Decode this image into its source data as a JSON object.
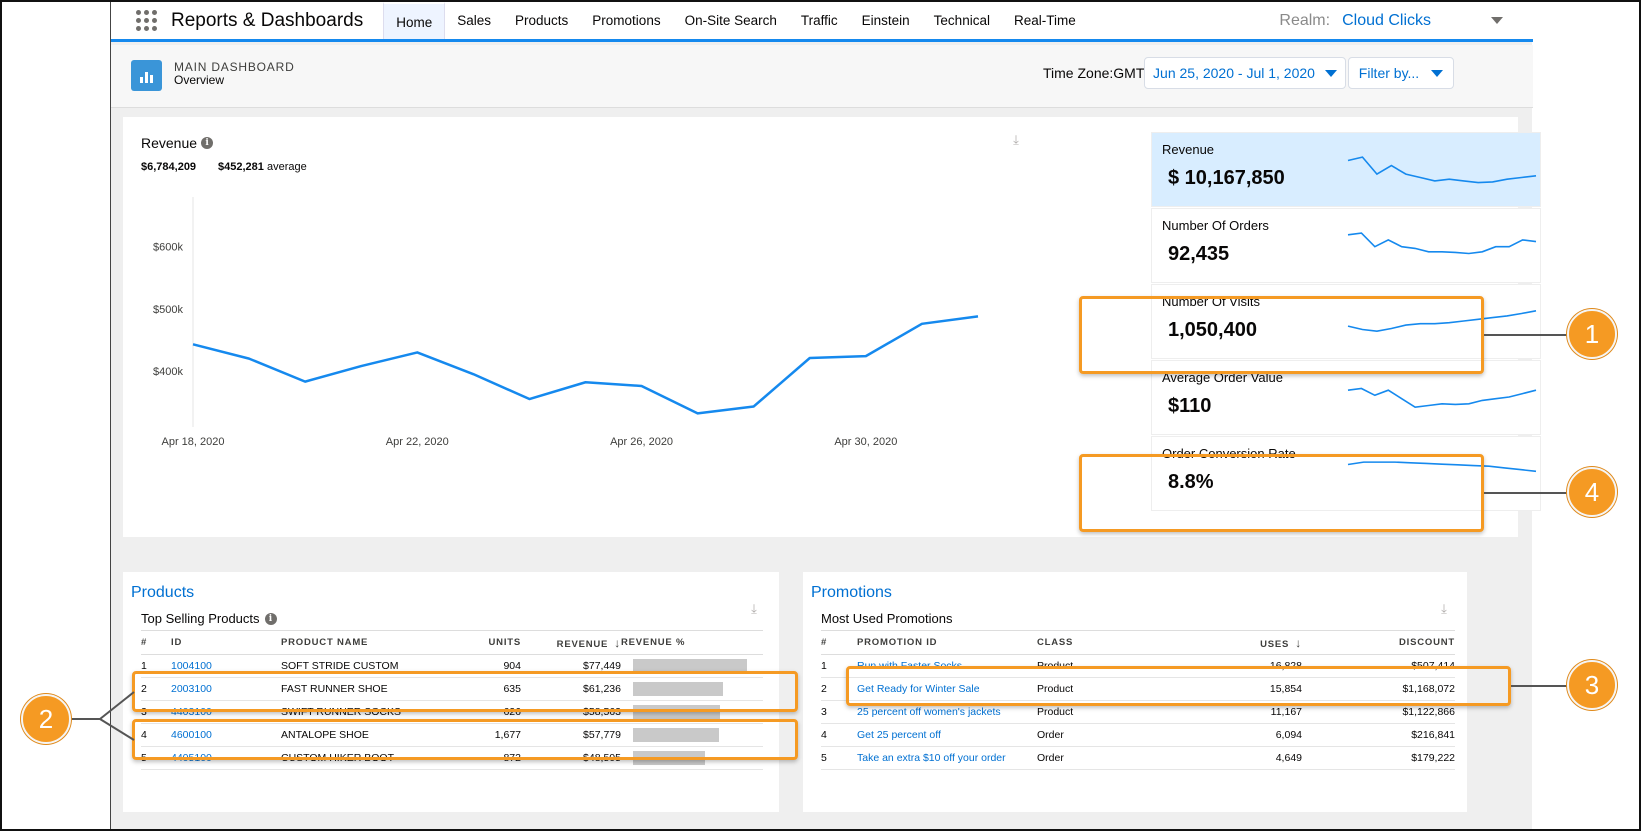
{
  "nav": {
    "app_title": "Reports & Dashboards",
    "tabs": [
      "Home",
      "Sales",
      "Products",
      "Promotions",
      "On-Site Search",
      "Traffic",
      "Einstein",
      "Technical",
      "Real-Time"
    ],
    "active_tab": "Home",
    "realm_label": "Realm:",
    "realm_value": "Cloud Clicks"
  },
  "header": {
    "title": "MAIN DASHBOARD",
    "subtitle": "Overview",
    "timezone_label": "Time Zone:GMT",
    "date_range": "Jun 25, 2020 - Jul 1, 2020",
    "filter_label": "Filter by..."
  },
  "revenue": {
    "title": "Revenue",
    "total": "$6,784,209",
    "average_value": "$452,281",
    "average_label": "average"
  },
  "chart_data": {
    "type": "line",
    "title": "Revenue",
    "x_ticks": [
      "Apr 18, 2020",
      "Apr 22, 2020",
      "Apr 26, 2020",
      "Apr 30, 2020"
    ],
    "y_ticks": [
      "$400k",
      "$500k",
      "$600k"
    ],
    "ylim": [
      310000,
      680000
    ],
    "xlim_days": [
      0,
      14
    ],
    "x": [
      "Apr 18, 2020",
      "Apr 19, 2020",
      "Apr 20, 2020",
      "Apr 21, 2020",
      "Apr 22, 2020",
      "Apr 23, 2020",
      "Apr 24, 2020",
      "Apr 25, 2020",
      "Apr 26, 2020",
      "Apr 27, 2020",
      "Apr 28, 2020",
      "Apr 29, 2020",
      "Apr 30, 2020",
      "May 1, 2020",
      "May 2, 2020"
    ],
    "values": [
      443000,
      420000,
      383000,
      408000,
      430000,
      395000,
      355000,
      382000,
      376000,
      332000,
      343000,
      421000,
      424000,
      476000,
      488000
    ],
    "color": "#1589ee",
    "grid": false
  },
  "kpis": [
    {
      "label": "Revenue",
      "value": "$ 10,167,850",
      "selected": true,
      "spark": [
        0.75,
        0.85,
        0.35,
        0.6,
        0.35,
        0.25,
        0.15,
        0.2,
        0.15,
        0.1,
        0.12,
        0.2,
        0.25,
        0.3
      ]
    },
    {
      "label": "Number Of Orders",
      "value": "92,435",
      "selected": false,
      "spark": [
        0.8,
        0.85,
        0.45,
        0.65,
        0.45,
        0.4,
        0.3,
        0.3,
        0.28,
        0.25,
        0.3,
        0.45,
        0.45,
        0.65,
        0.6
      ]
    },
    {
      "label": "Number Of Visits",
      "value": "1,050,400",
      "selected": false,
      "spark": [
        0.35,
        0.25,
        0.2,
        0.28,
        0.38,
        0.42,
        0.42,
        0.45,
        0.5,
        0.55,
        0.6,
        0.65,
        0.72,
        0.8
      ]
    },
    {
      "label": "Average Order Value",
      "value": "$110",
      "selected": false,
      "spark": [
        0.7,
        0.75,
        0.55,
        0.7,
        0.45,
        0.2,
        0.25,
        0.3,
        0.28,
        0.3,
        0.4,
        0.45,
        0.5,
        0.6,
        0.7
      ]
    },
    {
      "label": "Order Conversion Rate",
      "value": "8.8%",
      "selected": false,
      "spark": [
        0.75,
        0.82,
        0.82,
        0.82,
        0.8,
        0.78,
        0.76,
        0.74,
        0.72,
        0.7,
        0.65,
        0.6,
        0.55
      ]
    }
  ],
  "callouts": [
    "1",
    "2",
    "3",
    "4"
  ],
  "products": {
    "title": "Products",
    "subtitle": "Top Selling Products",
    "columns": [
      "#",
      "ID",
      "PRODUCT NAME",
      "UNITS",
      "REVENUE",
      "REVENUE %"
    ],
    "sort_arrow": "↓",
    "rows": [
      {
        "rank": "1",
        "id": "1004100",
        "name": "SOFT STRIDE CUSTOM",
        "units": "904",
        "revenue": "$77,449",
        "pct": 1.0
      },
      {
        "rank": "2",
        "id": "2003100",
        "name": "FAST RUNNER SHOE",
        "units": "635",
        "revenue": "$61,236",
        "pct": 0.79
      },
      {
        "rank": "3",
        "id": "4403100",
        "name": "SWIFT RUNNER SOCKS",
        "units": "626",
        "revenue": "$58,563",
        "pct": 0.76
      },
      {
        "rank": "4",
        "id": "4600100",
        "name": "ANTALOPE SHOE",
        "units": "1,677",
        "revenue": "$57,779",
        "pct": 0.75
      },
      {
        "rank": "5",
        "id": "4405100",
        "name": "CUSTOM HIKER BOOT",
        "units": "872",
        "revenue": "$48,505",
        "pct": 0.63
      }
    ]
  },
  "promotions": {
    "title": "Promotions",
    "subtitle": "Most Used Promotions",
    "columns": [
      "#",
      "PROMOTION ID",
      "CLASS",
      "USES",
      "DISCOUNT"
    ],
    "sort_arrow": "↓",
    "rows": [
      {
        "rank": "1",
        "id": "Run with Faster Socks",
        "class": "Product",
        "uses": "16,828",
        "discount": "$507,414"
      },
      {
        "rank": "2",
        "id": "Get Ready for Winter Sale",
        "class": "Product",
        "uses": "15,854",
        "discount": "$1,168,072"
      },
      {
        "rank": "3",
        "id": "25 percent off women's jackets",
        "class": "Product",
        "uses": "11,167",
        "discount": "$1,122,866"
      },
      {
        "rank": "4",
        "id": "Get 25 percent off",
        "class": "Order",
        "uses": "6,094",
        "discount": "$216,841"
      },
      {
        "rank": "5",
        "id": "Take an extra $10 off your order",
        "class": "Order",
        "uses": "4,649",
        "discount": "$179,222"
      }
    ]
  },
  "icons": {
    "info": "info-icon",
    "download": "download-icon",
    "app_launcher": "waffle-icon",
    "dashboard": "bar-chart-icon"
  },
  "colors": {
    "accent": "#1589ee",
    "link": "#0070d2",
    "highlight": "#f59a23",
    "selected_tile": "#d8edff"
  }
}
